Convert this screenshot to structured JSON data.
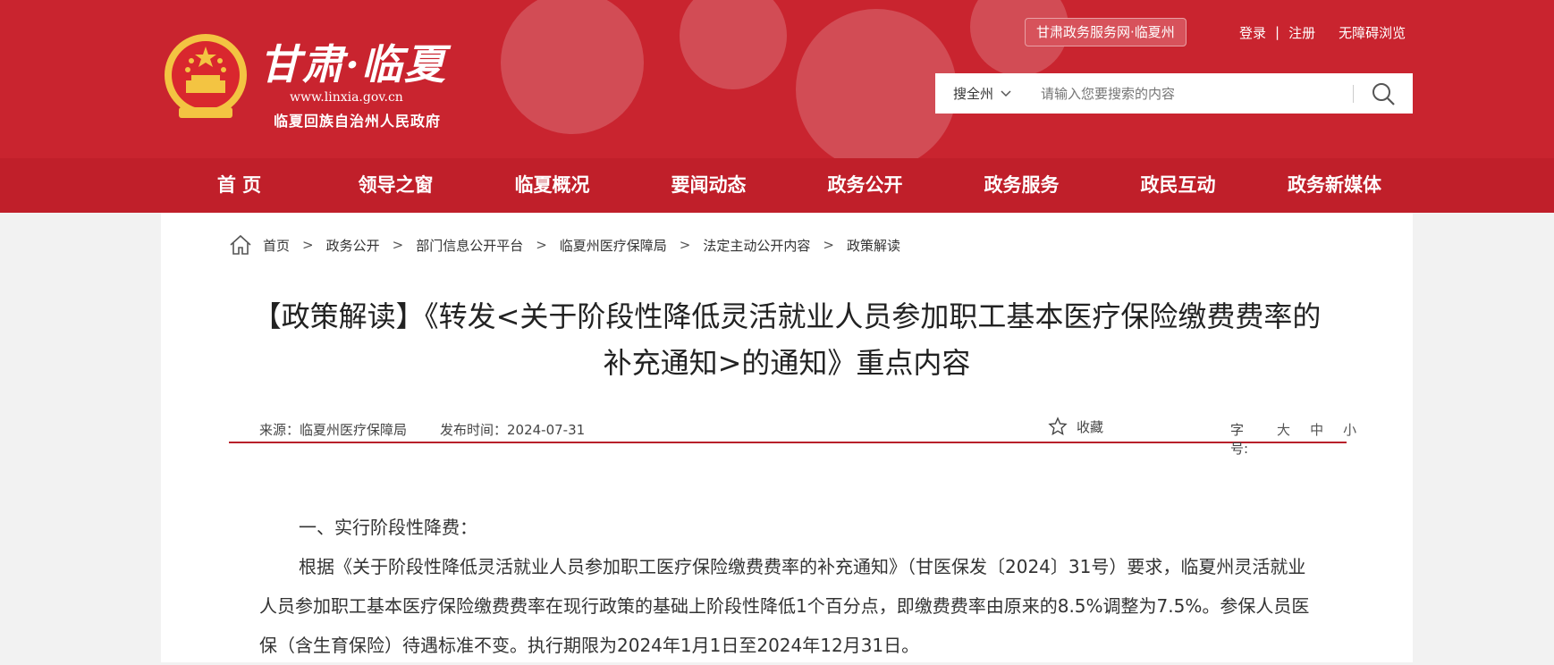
{
  "header": {
    "brand_title": "甘肃·临夏",
    "brand_url": "www.linxia.gov.cn",
    "brand_subtitle": "临夏回族自治州人民政府",
    "site_badge": "甘肃政务服务网·临夏州",
    "login": "登录",
    "divider": "|",
    "register": "注册",
    "accessibility": "无障碍浏览",
    "search": {
      "scope": "搜全州",
      "placeholder": "请输入您要搜索的内容"
    },
    "colors": {
      "primary": "#c9242f",
      "nav": "#c01f2a"
    }
  },
  "nav": {
    "items": [
      "首 页",
      "领导之窗",
      "临夏概况",
      "要闻动态",
      "政务公开",
      "政务服务",
      "政民互动",
      "政务新媒体"
    ]
  },
  "breadcrumb": {
    "items": [
      "首页",
      "政务公开",
      "部门信息公开平台",
      "临夏州医疗保障局",
      "法定主动公开内容",
      "政策解读"
    ],
    "separator": ">"
  },
  "article": {
    "title_line1": "【政策解读】《转发<关于阶段性降低灵活就业人员参加职工基本医疗保险缴费费率的",
    "title_line2": "补充通知>的通知》重点内容",
    "source": "来源：临夏州医疗保障局",
    "pubdate": "发布时间：2024-07-31",
    "favorite": "收藏",
    "font_label": "字号:",
    "font_large": "大",
    "font_medium": "中",
    "font_small": "小",
    "heading1": "一、实行阶段性降费：",
    "para1": "根据《关于阶段性降低灵活就业人员参加职工医疗保险缴费费率的补充通知》（甘医保发〔2024〕31号）要求，临夏州灵活就业人员参加职工基本医疗保险缴费费率在现行政策的基础上阶段性降低1个百分点，即缴费费率由原来的8.5%调整为7.5%。参保人员医保（含生育保险）待遇标准不变。执行期限为2024年1月1日至2024年12月31日。"
  }
}
